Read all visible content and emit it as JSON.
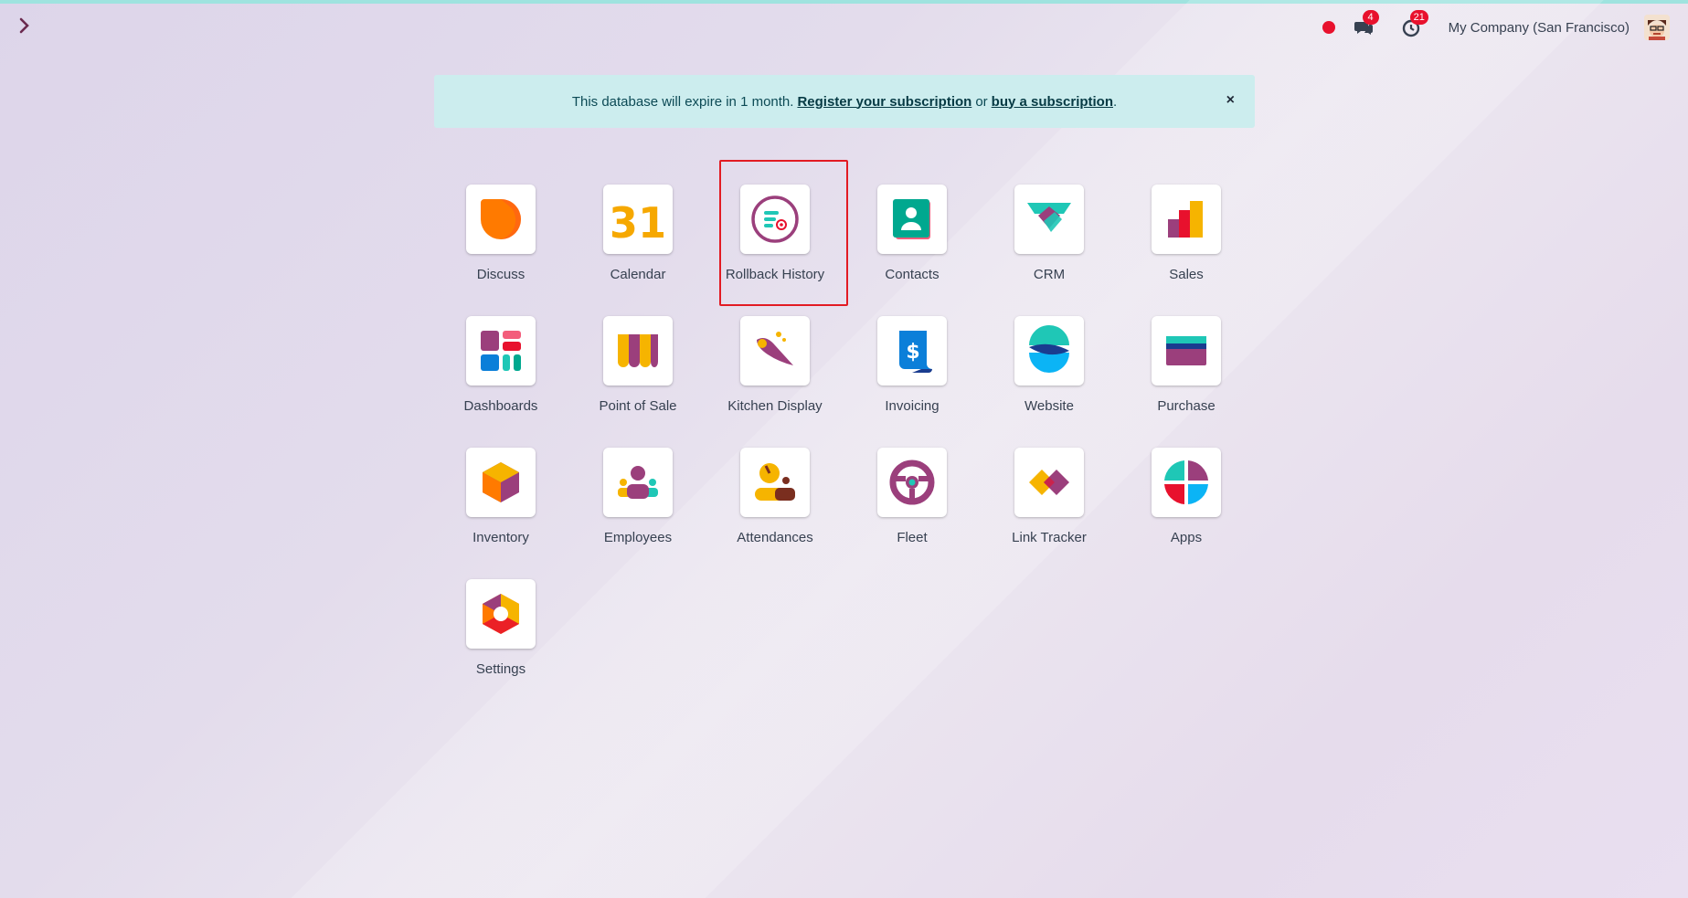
{
  "navbar": {
    "toggle_icon": "chevron-right-icon",
    "messages_badge": "4",
    "activities_badge": "21",
    "company": "My Company (San Francisco)"
  },
  "banner": {
    "text_before": "This database will expire in 1 month.",
    "register_link": "Register your subscription",
    "or_text": "or",
    "buy_link": "buy a subscription",
    "period": ".",
    "close_label": "×"
  },
  "apps": [
    {
      "label": "Discuss",
      "icon": "discuss-icon"
    },
    {
      "label": "Calendar",
      "icon": "calendar-icon"
    },
    {
      "label": "Rollback History",
      "icon": "rollback-history-icon"
    },
    {
      "label": "Contacts",
      "icon": "contacts-icon"
    },
    {
      "label": "CRM",
      "icon": "crm-icon"
    },
    {
      "label": "Sales",
      "icon": "sales-icon"
    },
    {
      "label": "Dashboards",
      "icon": "dashboards-icon"
    },
    {
      "label": "Point of Sale",
      "icon": "point-of-sale-icon"
    },
    {
      "label": "Kitchen Display",
      "icon": "kitchen-display-icon"
    },
    {
      "label": "Invoicing",
      "icon": "invoicing-icon"
    },
    {
      "label": "Website",
      "icon": "website-icon"
    },
    {
      "label": "Purchase",
      "icon": "purchase-icon"
    },
    {
      "label": "Inventory",
      "icon": "inventory-icon"
    },
    {
      "label": "Employees",
      "icon": "employees-icon"
    },
    {
      "label": "Attendances",
      "icon": "attendances-icon"
    },
    {
      "label": "Fleet",
      "icon": "fleet-icon"
    },
    {
      "label": "Link Tracker",
      "icon": "link-tracker-icon"
    },
    {
      "label": "Apps",
      "icon": "apps-icon"
    },
    {
      "label": "Settings",
      "icon": "settings-icon"
    }
  ],
  "calendar_icon_text": "31",
  "invoicing_icon_text": "$",
  "colors": {
    "brand_purple": "#9b3f7c",
    "accent_teal": "#1fc7b6",
    "badge_red": "#e8112d",
    "banner_bg": "#ccedee",
    "highlight_red": "#e21b23"
  }
}
